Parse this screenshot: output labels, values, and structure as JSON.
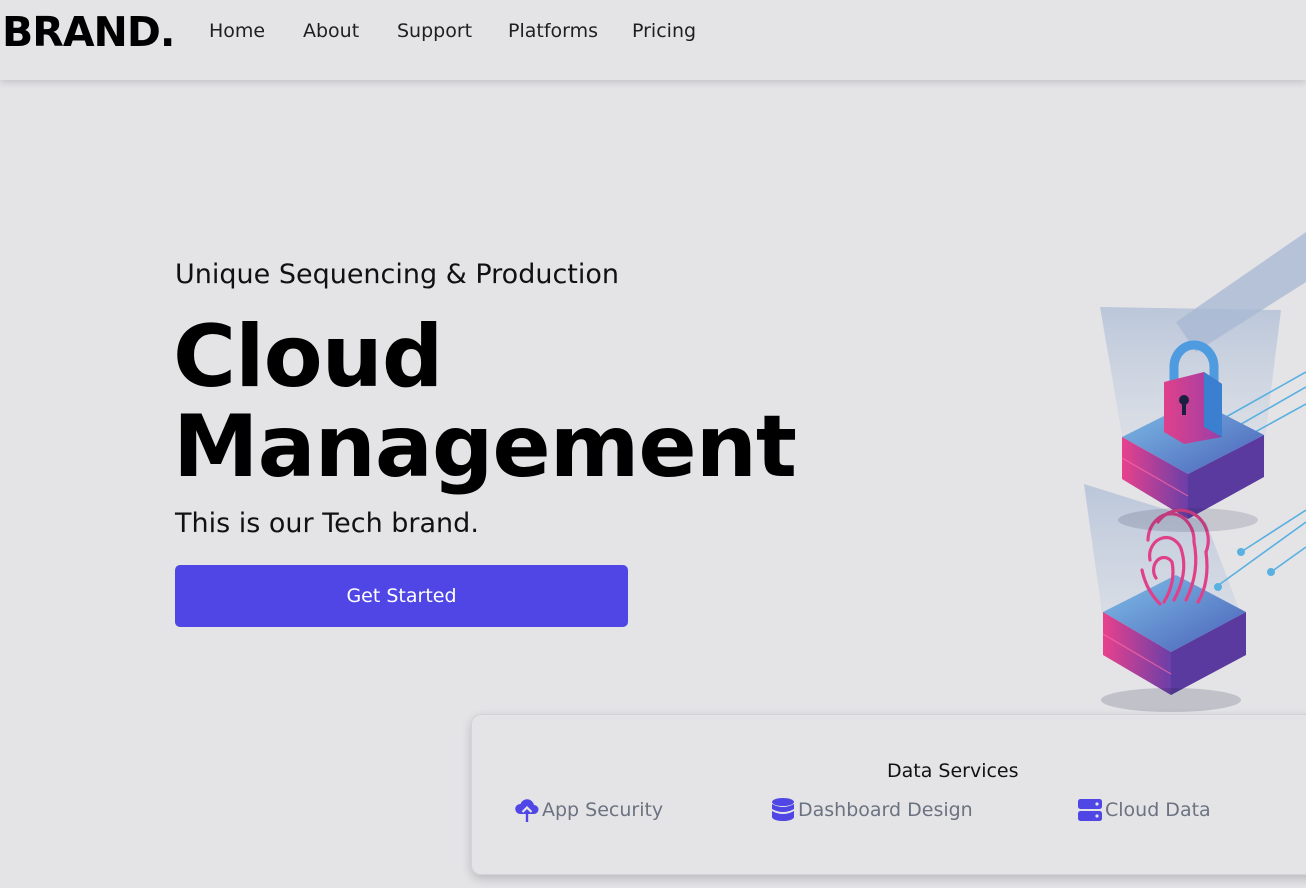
{
  "brand": "BRAND.",
  "nav": {
    "items": [
      {
        "label": "Home"
      },
      {
        "label": "About"
      },
      {
        "label": "Support"
      },
      {
        "label": "Platforms"
      },
      {
        "label": "Pricing"
      }
    ]
  },
  "hero": {
    "subtitle": "Unique Sequencing & Production",
    "title_line1": "Cloud",
    "title_line2": "Management",
    "description": "This is our Tech brand.",
    "cta_label": "Get Started",
    "illustration_icons": [
      "padlock-icon",
      "fingerprint-icon"
    ]
  },
  "services": {
    "title": "Data Services",
    "items": [
      {
        "label": "App Security",
        "icon": "cloud-upload-icon"
      },
      {
        "label": "Dashboard Design",
        "icon": "database-icon"
      },
      {
        "label": "Cloud Data",
        "icon": "server-icon"
      }
    ]
  },
  "colors": {
    "accent": "#4f46e5",
    "background": "#e4e4e7",
    "illustration_pink": "#e0408a",
    "illustration_blue": "#5ab0e0"
  }
}
